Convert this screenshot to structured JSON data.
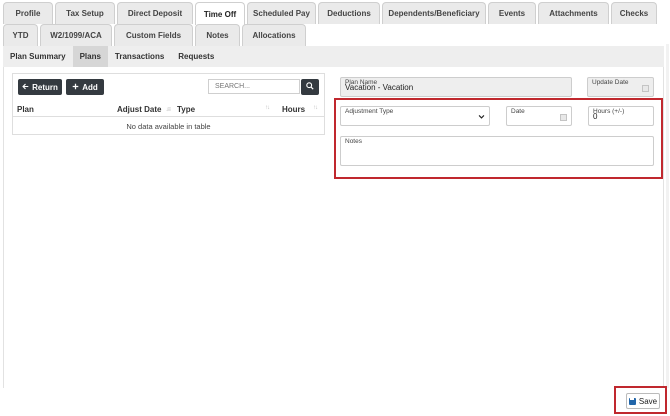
{
  "tabs_row1": [
    {
      "label": "Profile",
      "w": 0
    },
    {
      "label": "Tax Setup"
    },
    {
      "label": "Direct Deposit"
    },
    {
      "label": "Time Off",
      "active": true
    },
    {
      "label": "Scheduled Pay"
    },
    {
      "label": "Deductions"
    },
    {
      "label": "Dependents/Beneficiary"
    },
    {
      "label": "Events"
    },
    {
      "label": "Attachments"
    },
    {
      "label": "Checks"
    }
  ],
  "tabs_row2": [
    "YTD",
    "W2/1099/ACA",
    "Custom Fields",
    "Notes",
    "Allocations"
  ],
  "subnav": [
    "Plan Summary",
    "Plans",
    "Transactions",
    "Requests"
  ],
  "subnav_active": "Plans",
  "list": {
    "return_label": "Return",
    "add_label": "Add",
    "search_placeholder": "SEARCH...",
    "columns": [
      "Plan",
      "Adjust Date",
      "Type",
      "Hours"
    ],
    "empty_text": "No data available in table"
  },
  "form": {
    "plan_name_label": "Plan Name",
    "plan_name_value": "Vacation - Vacation",
    "update_date_label": "Update Date",
    "adjustment_type_label": "Adjustment Type",
    "date_label": "Date",
    "hours_label": "Hours (+/-)",
    "hours_value": "0",
    "notes_label": "Notes"
  },
  "save_label": "Save",
  "colors": {
    "highlight": "#c0282e",
    "dark_button": "#343a40"
  }
}
